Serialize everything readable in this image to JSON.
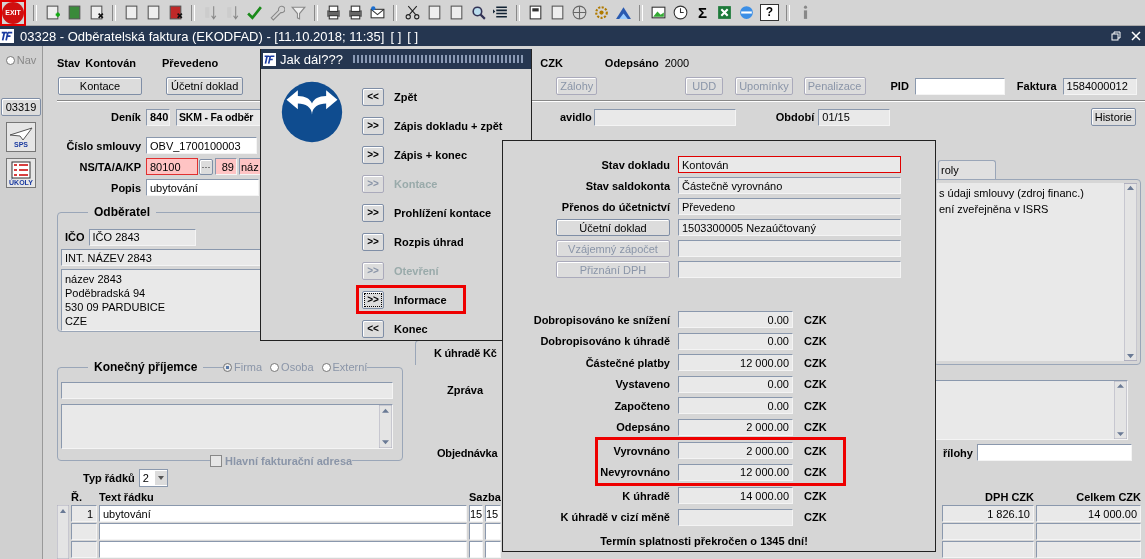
{
  "toolbar": {
    "exit": "EXIT",
    "sum": "Σ",
    "help": "?"
  },
  "window": {
    "title": "03328 - Odběratelská faktura (EKODFAD) - [11.10.2018; 11:35]",
    "tags": [
      "[ ]",
      "[ ]"
    ]
  },
  "nav": {
    "label": "Nav",
    "selected": false
  },
  "side": {
    "code": "03319",
    "sps": "SPS",
    "tasks": "ÚKOLY"
  },
  "header": {
    "stav_label": "Stav",
    "stav": "Kontován",
    "prevod": "Převedeno",
    "currency": "CZK",
    "odepsano_label": "Odepsáno",
    "odepsano": "2000"
  },
  "buttons": [
    {
      "label": "Kontace",
      "disabled": false
    },
    {
      "label": "Účetní doklad",
      "disabled": false
    },
    {
      "label": "Zálohy",
      "disabled": true
    },
    {
      "label": "UDD",
      "disabled": true
    },
    {
      "label": "Upomínky",
      "disabled": true
    },
    {
      "label": "Penalizace",
      "disabled": true
    }
  ],
  "pid": {
    "label": "PID"
  },
  "faktura": {
    "label": "Faktura",
    "value": "1584000012"
  },
  "denik": {
    "label": "Deník",
    "code": "840",
    "name": "SKM - Fa odběr"
  },
  "pravidlo": {
    "label": "avidlo"
  },
  "obdobi": {
    "label": "Období",
    "value": "01/15"
  },
  "history_button": "Historie",
  "smlouva": {
    "label": "Číslo smlouvy",
    "value": "OBV_1700100003"
  },
  "ns": {
    "label": "NS/TA/A/KP",
    "value": "80100",
    "more": "···",
    "code": "89",
    "name": "náz"
  },
  "popis": {
    "label": "Popis",
    "value": "ubytování"
  },
  "odberatel": {
    "title": "Odběratel",
    "ico_label": "IČO",
    "ico": "IČO 2843",
    "name": "INT. NÁZEV 2843",
    "address": [
      "název 2843",
      "Poděbradská 94",
      "530 09 PARDUBICE",
      "CZE"
    ]
  },
  "prijemce": {
    "title": "Konečný příjemce",
    "options": [
      {
        "label": "Firma",
        "selected": true
      },
      {
        "label": "Osoba",
        "selected": false
      },
      {
        "label": "Externí",
        "selected": false
      }
    ],
    "main_address": {
      "label": "Hlavní fakturační adresa",
      "checked": false
    }
  },
  "right": {
    "tab": "roly",
    "notes": [
      "s údaji smlouvy (zdroj financ.)",
      "ení zveřejněna v ISRS"
    ],
    "k_uhrade": "K úhradě Kč",
    "zprava": "Zpráva",
    "objednavka": "Objednávka",
    "prilohy": "řílohy"
  },
  "lines": {
    "type_label": "Typ řádků",
    "type_value": "2",
    "col_no": "Ř.",
    "col_text": "Text řádku",
    "col_rate": "Sazba",
    "col_vat": "DPH CZK",
    "col_total": "Celkem CZK",
    "rows": [
      {
        "no": "1",
        "text": "ubytování",
        "rate": "15",
        "rate2": "15",
        "vat": "1 826.10",
        "total": "14 000.00"
      },
      {
        "no": "",
        "text": "",
        "rate": "",
        "rate2": "",
        "vat": "",
        "total": ""
      },
      {
        "no": "",
        "text": "",
        "rate": "",
        "rate2": "",
        "vat": "",
        "total": ""
      }
    ]
  },
  "dialog": {
    "title": "Jak dál???",
    "items": [
      {
        "arrow": "<<",
        "label": "Zpět",
        "disabled": false,
        "highlighted": false
      },
      {
        "arrow": ">>",
        "label": "Zápis dokladu + zpět",
        "disabled": false,
        "highlighted": false
      },
      {
        "arrow": ">>",
        "label": "Zápis + konec",
        "disabled": false,
        "highlighted": false
      },
      {
        "arrow": ">>",
        "label": "Kontace",
        "disabled": true,
        "highlighted": false
      },
      {
        "arrow": ">>",
        "label": "Prohlížení kontace",
        "disabled": false,
        "highlighted": false
      },
      {
        "arrow": ">>",
        "label": "Rozpis úhrad",
        "disabled": false,
        "highlighted": false
      },
      {
        "arrow": ">>",
        "label": "Otevření",
        "disabled": true,
        "highlighted": false
      },
      {
        "arrow": ">>",
        "label": "Informace",
        "disabled": false,
        "highlighted": true
      },
      {
        "arrow": "<<",
        "label": "Konec",
        "disabled": false,
        "highlighted": false
      }
    ]
  },
  "info": {
    "status": [
      {
        "kind": "text",
        "label": "Stav dokladu",
        "value": "Kontován",
        "highlighted": true
      },
      {
        "kind": "text",
        "label": "Stav saldokonta",
        "value": "Částečně vyrovnáno",
        "highlighted": false
      },
      {
        "kind": "text",
        "label": "Přenos do účetnictví",
        "value": "Převedeno",
        "highlighted": false
      },
      {
        "kind": "button",
        "label": "Účetní doklad",
        "value": "1503300005 Nezaúčtovaný",
        "disabled": false
      },
      {
        "kind": "button",
        "label": "Vzájemný zápočet",
        "disabled": true
      },
      {
        "kind": "button",
        "label": "Přiznání DPH",
        "disabled": true
      }
    ],
    "amounts": [
      {
        "label": "Dobropisováno ke snížení",
        "value": "0.00",
        "currency": "CZK",
        "highlighted": false
      },
      {
        "label": "Dobropisováno k úhradě",
        "value": "0.00",
        "currency": "CZK",
        "highlighted": false
      },
      {
        "label": "Částečné platby",
        "value": "12 000.00",
        "currency": "CZK",
        "highlighted": false
      },
      {
        "label": "Vystaveno",
        "value": "0.00",
        "currency": "CZK",
        "highlighted": false
      },
      {
        "label": "Započteno",
        "value": "0.00",
        "currency": "CZK",
        "highlighted": false
      },
      {
        "label": "Odepsáno",
        "value": "2 000.00",
        "currency": "CZK",
        "highlighted": false
      },
      {
        "label": "Vyrovnáno",
        "value": "2 000.00",
        "currency": "CZK",
        "highlighted": true
      },
      {
        "label": "Nevyrovnáno",
        "value": "12 000.00",
        "currency": "CZK",
        "highlighted": true
      },
      {
        "label": "K úhradě",
        "value": "14 000.00",
        "currency": "CZK",
        "highlighted": false
      },
      {
        "label": "K úhradě v cizí měně",
        "currency": "CZK",
        "highlighted": false
      }
    ],
    "footer": "Termín splatnosti překročen o 1345 dní!"
  }
}
